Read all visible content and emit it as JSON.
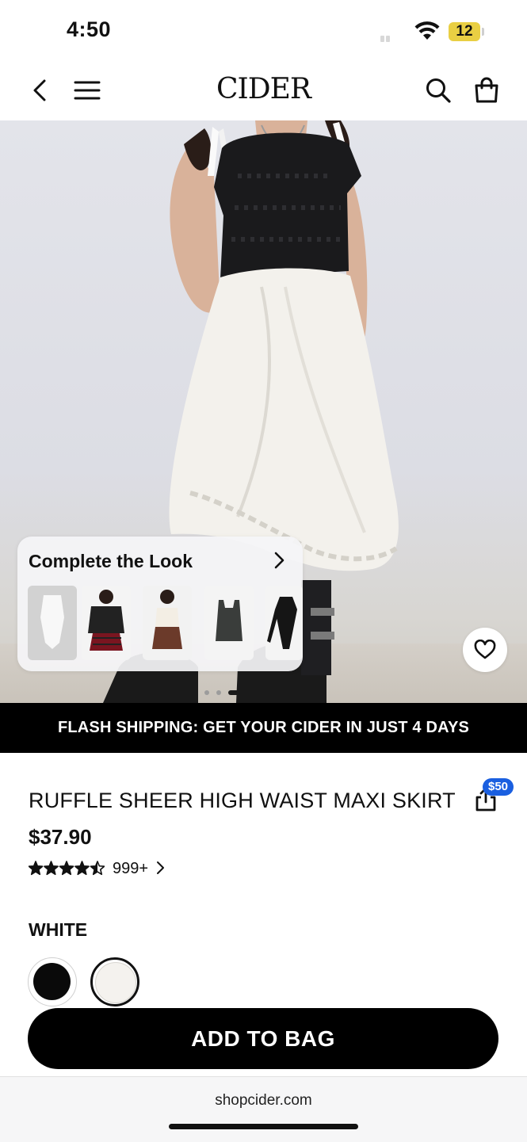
{
  "status_bar": {
    "time": "4:50",
    "battery": "12"
  },
  "nav": {
    "logo": "CIDER"
  },
  "complete_look": {
    "title": "Complete the Look"
  },
  "banner": {
    "text": "FLASH SHIPPING: GET YOUR CIDER IN JUST 4 DAYS"
  },
  "product": {
    "title": "RUFFLE SHEER HIGH WAIST MAXI SKIRT",
    "price": "$37.90",
    "rating": 4.5,
    "reviews": "999+",
    "share_badge": "$50"
  },
  "color": {
    "selected_label": "WHITE",
    "options": [
      "#0a0a0a",
      "#f4f2ee"
    ]
  },
  "cta": {
    "add_to_bag": "ADD TO BAG"
  },
  "browser": {
    "url": "shopcider.com"
  },
  "colors": {
    "accent": "#1a5fe0",
    "battery": "#e9cf43",
    "primary": "#000000"
  }
}
